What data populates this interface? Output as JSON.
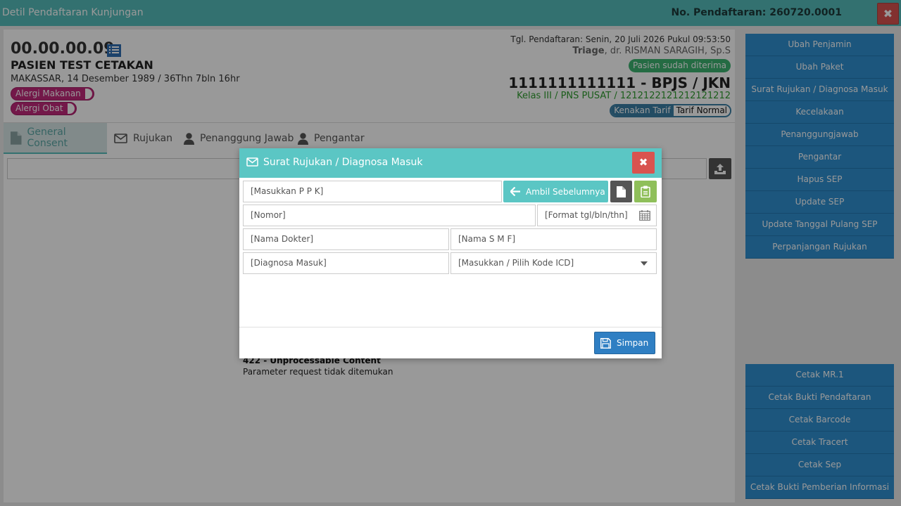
{
  "window": {
    "title": "Detil Pendaftaran Kunjungan",
    "registration": "No. Pendaftaran: 260720.0001",
    "close": "✖"
  },
  "patient": {
    "rm_number": "00.00.00.09",
    "name": "PASIEN TEST CETAKAN",
    "birth": "MAKASSAR, 14 Desember 1989 / 36Thn 7bln 16hr",
    "tags": [
      "Alergi Makanan",
      "Alergi Obat"
    ],
    "reg_date": "Tgl. Pendaftaran: Senin, 20 Juli 2026 Pukul 09:53:50",
    "unit": "Triage",
    "doctor": ", dr. RISMAN SARAGIH, Sp.S",
    "status": "Pasien sudah diterima",
    "guarantor": "1111111111111 - BPJS / JKN",
    "class_line": "Kelas III / PNS PUSAT / 1212122121212121212",
    "tarif_label": "Kenakan Tarif",
    "tarif_value": "Tarif Normal"
  },
  "tabs": [
    {
      "label": "General Consent",
      "icon": "file-icon"
    },
    {
      "label": "Rujukan",
      "icon": "envelope-icon"
    },
    {
      "label": "Penanggung Jawab",
      "icon": "user-icon"
    },
    {
      "label": "Pengantar",
      "icon": "user-icon"
    }
  ],
  "error": {
    "title": "422 - Unprocessable Content",
    "message": "Parameter request tidak ditemukan"
  },
  "sidebar_top": [
    "Ubah Penjamin",
    "Ubah Paket",
    "Surat Rujukan / Diagnosa Masuk",
    "Kecelakaan",
    "Penanggungjawab",
    "Pengantar",
    "Hapus SEP",
    "Update SEP",
    "Update Tanggal Pulang SEP",
    "Perpanjangan Rujukan"
  ],
  "sidebar_bottom": [
    "Cetak MR.1",
    "Cetak Bukti Pendaftaran",
    "Cetak Barcode",
    "Cetak Tracert",
    "Cetak Sep",
    "Cetak Bukti Pemberian Informasi"
  ],
  "modal": {
    "title": "Surat Rujukan / Diagnosa Masuk",
    "close": "✖",
    "ppk_placeholder": "[Masukkan P P K]",
    "prev_button": "Ambil Sebelumnya",
    "nomor_placeholder": "[Nomor]",
    "tgl_placeholder": "[Format tgl/bln/thn]",
    "dokter_placeholder": "[Nama Dokter]",
    "smf_placeholder": "[Nama S M F]",
    "diagnosa_placeholder": "[Diagnosa Masuk]",
    "icd_placeholder": "[Masukkan / Pilih Kode ICD]",
    "save_button": "Simpan"
  },
  "colors": {
    "header": "#56bdbb",
    "modal_header": "#5bc6c4",
    "sidebar": "#2f8fd0",
    "danger": "#d9534f",
    "allergy_tag": "#c0287a",
    "status_green": "#3cb371"
  }
}
